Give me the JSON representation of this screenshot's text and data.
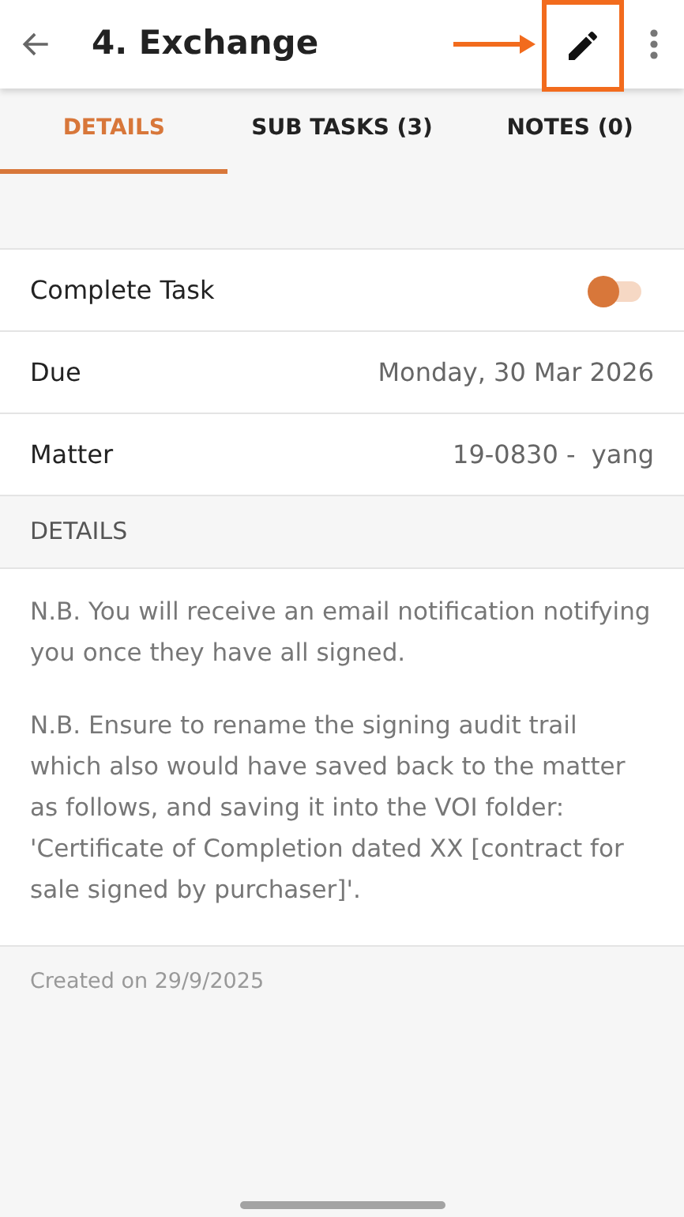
{
  "app_bar": {
    "title": "4. Exchange",
    "edit_highlighted": true
  },
  "tabs": [
    {
      "label": "DETAILS",
      "selected": true
    },
    {
      "label": "SUB TASKS (3)",
      "selected": false
    },
    {
      "label": "NOTES (0)",
      "selected": false
    }
  ],
  "fields": [
    {
      "kind": "toggle",
      "label": "Complete Task",
      "on": false
    },
    {
      "kind": "value",
      "label": "Due",
      "value": "Monday, 30 Mar 2026"
    },
    {
      "kind": "value",
      "label": "Matter",
      "value": "19-0830 -  yang"
    }
  ],
  "details": {
    "heading": "DETAILS",
    "paragraphs": [
      "N.B. You will receive an email notification notifying you once they have all signed.",
      "N.B. Ensure to rename the signing audit trail which also would have saved back to the matter as follows, and saving it into the VOI folder: 'Certificate of Completion dated XX [contract for sale signed by purchaser]'."
    ]
  },
  "created": "Created on 29/9/2025"
}
